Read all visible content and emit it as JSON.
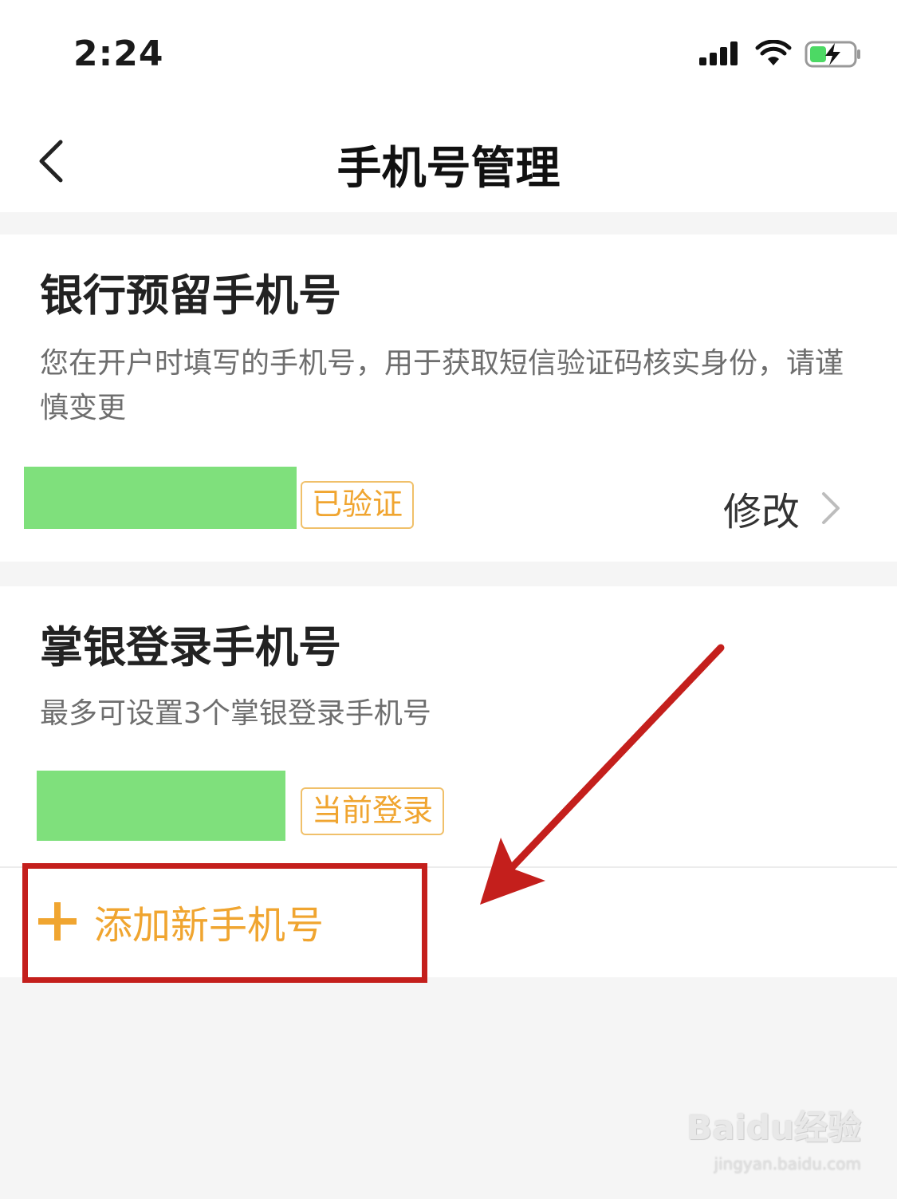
{
  "status_bar": {
    "time": "2:24"
  },
  "nav": {
    "title": "手机号管理"
  },
  "bank_section": {
    "title": "银行预留手机号",
    "description": "您在开户时填写的手机号，用于获取短信验证码核实身份，请谨慎变更",
    "badge": "已验证",
    "modify_label": "修改"
  },
  "login_section": {
    "title": "掌银登录手机号",
    "description": "最多可设置3个掌银登录手机号",
    "badge": "当前登录",
    "add_label": "添加新手机号"
  },
  "watermark": {
    "logo": "Baidu经验",
    "url": "jingyan.baidu.com"
  },
  "colors": {
    "accent": "#f0a530",
    "mask": "#7fe07c",
    "highlight": "#c41f1c"
  }
}
